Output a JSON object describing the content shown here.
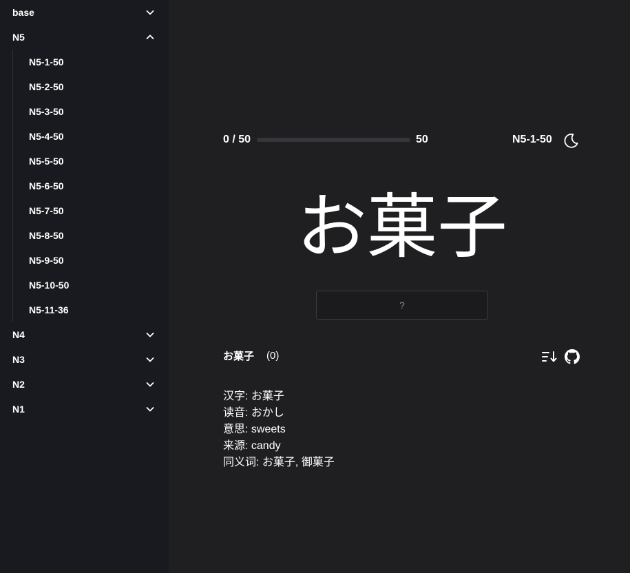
{
  "sidebar": {
    "groups": [
      {
        "label": "base",
        "expanded": false
      },
      {
        "label": "N5",
        "expanded": true
      },
      {
        "label": "N4",
        "expanded": false
      },
      {
        "label": "N3",
        "expanded": false
      },
      {
        "label": "N2",
        "expanded": false
      },
      {
        "label": "N1",
        "expanded": false
      }
    ],
    "n5_items": [
      {
        "label": "N5-1-50"
      },
      {
        "label": "N5-2-50"
      },
      {
        "label": "N5-3-50"
      },
      {
        "label": "N5-4-50"
      },
      {
        "label": "N5-5-50"
      },
      {
        "label": "N5-6-50"
      },
      {
        "label": "N5-7-50"
      },
      {
        "label": "N5-8-50"
      },
      {
        "label": "N5-9-50"
      },
      {
        "label": "N5-10-50"
      },
      {
        "label": "N5-11-36"
      }
    ]
  },
  "progress": {
    "counter": "0 / 50",
    "total": "50",
    "fraction": 0
  },
  "current_set": "N5-1-50",
  "icons": {
    "theme_toggle": "moon-icon",
    "sort": "sort-icon",
    "repo": "github-icon",
    "expand": "chevron-down-icon",
    "collapse": "chevron-up-icon"
  },
  "card": {
    "word": "お菓子",
    "input_placeholder": "?",
    "input_value": ""
  },
  "detail": {
    "title": "お菓子",
    "count": "(0)",
    "lines": [
      "汉字: お菓子",
      "读音: おかし",
      "意思: sweets",
      "来源: candy",
      "同义词: お菓子, 御菓子"
    ]
  },
  "colors": {
    "background": "#1f1f21",
    "sidebar": "#181a1f",
    "text": "#ffffff",
    "progress_track": "#34363b"
  }
}
